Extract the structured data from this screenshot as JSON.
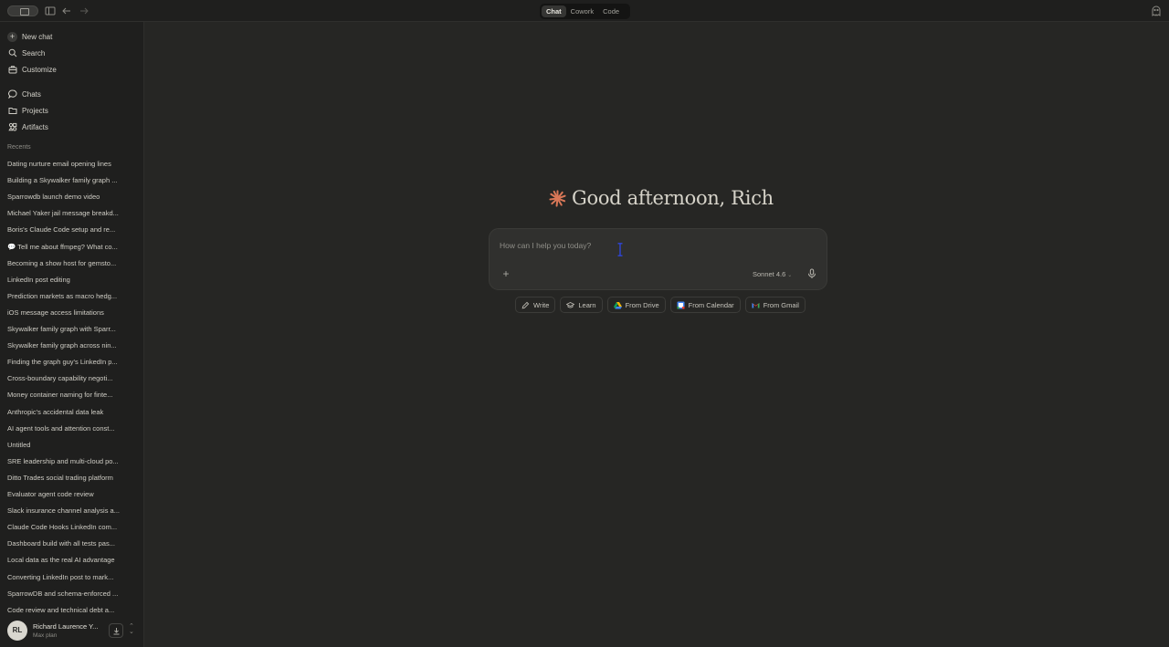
{
  "topbar": {
    "tabs": [
      {
        "label": "Chat",
        "active": true
      },
      {
        "label": "Cowork",
        "active": false
      },
      {
        "label": "Code",
        "active": false
      }
    ]
  },
  "sidebar": {
    "nav": [
      {
        "label": "New chat",
        "icon": "plus-icon"
      },
      {
        "label": "Search",
        "icon": "search-icon"
      },
      {
        "label": "Customize",
        "icon": "briefcase-icon"
      },
      {
        "label": "Chats",
        "icon": "chat-bubble-icon"
      },
      {
        "label": "Projects",
        "icon": "folder-icon"
      },
      {
        "label": "Artifacts",
        "icon": "artifacts-icon"
      }
    ],
    "recents_label": "Recents",
    "recents": [
      "Dating nurture email opening lines",
      "Building a Skywalker family graph ...",
      "Sparrowdb launch demo video",
      "Michael Yaker jail message breakd...",
      "Boris's Claude Code setup and re...",
      "💬 Tell me about ffmpeg? What co...",
      "Becoming a show host for gemsto...",
      "LinkedIn post editing",
      "Prediction markets as macro hedg...",
      "iOS message access limitations",
      "Skywalker family graph with Sparr...",
      "Skywalker family graph across nin...",
      "Finding the graph guy's LinkedIn p...",
      "Cross-boundary capability negoti...",
      "Money container naming for finte...",
      "Anthropic's accidental data leak",
      "AI agent tools and attention const...",
      "Untitled",
      "SRE leadership and multi-cloud po...",
      "Ditto Trades social trading platform",
      "Evaluator agent code review",
      "Slack insurance channel analysis a...",
      "Claude Code Hooks LinkedIn com...",
      "Dashboard build with all tests pas...",
      "Local data as the real AI advantage",
      "Converting LinkedIn post to mark...",
      "SparrowDB and schema-enforced ...",
      "Code review and technical debt a..."
    ],
    "user": {
      "initials": "RL",
      "name": "Richard Laurence Y...",
      "plan": "Max plan"
    }
  },
  "main": {
    "greeting": "Good afternoon, Rich",
    "composer": {
      "placeholder": "How can I help you today?",
      "value": "",
      "model": "Sonnet 4.6"
    },
    "chips": [
      {
        "label": "Write",
        "icon": "pencil-icon"
      },
      {
        "label": "Learn",
        "icon": "graduation-cap-icon"
      },
      {
        "label": "From Drive",
        "icon": "google-drive-icon"
      },
      {
        "label": "From Calendar",
        "icon": "google-calendar-icon"
      },
      {
        "label": "From Gmail",
        "icon": "gmail-icon"
      }
    ]
  },
  "colors": {
    "background": "#262624",
    "sidebar": "#1f1f1e",
    "accent": "#d97757",
    "composer": "#30302e"
  }
}
